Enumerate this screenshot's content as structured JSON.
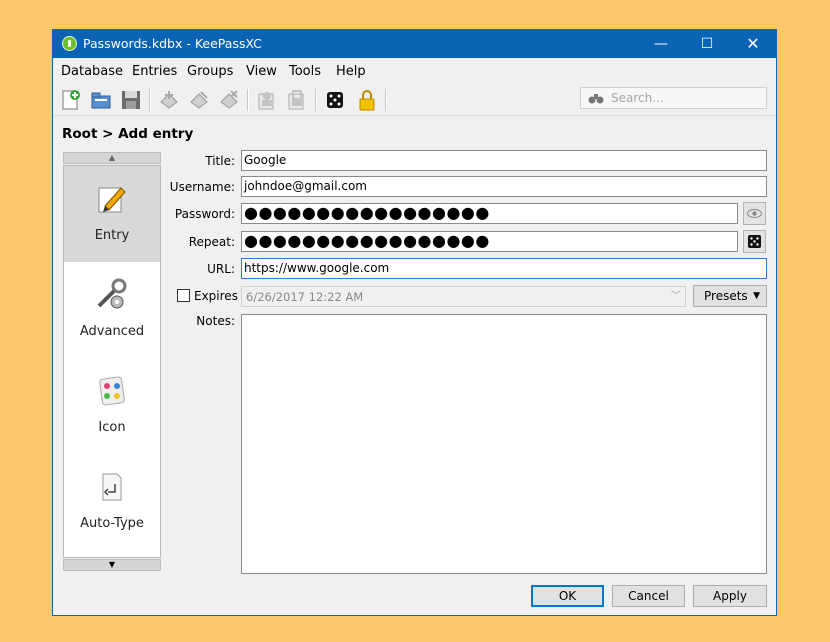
{
  "window": {
    "title": "Passwords.kdbx - KeePassXC",
    "controls": {
      "minimize": "—",
      "maximize": "☐",
      "close": "✕"
    }
  },
  "menu": [
    "Database",
    "Entries",
    "Groups",
    "View",
    "Tools",
    "Help"
  ],
  "toolbar": {
    "icons": [
      "new-database-icon",
      "open-database-icon",
      "save-database-icon",
      "add-entry-icon",
      "edit-entry-icon",
      "delete-entry-icon",
      "copy-username-icon",
      "copy-password-icon",
      "password-generator-icon",
      "lock-database-icon"
    ],
    "search_placeholder": "Search..."
  },
  "breadcrumb": "Root > Add entry",
  "categories": [
    {
      "label": "Entry",
      "icon": "pencil-note-icon",
      "selected": true
    },
    {
      "label": "Advanced",
      "icon": "tools-icon",
      "selected": false
    },
    {
      "label": "Icon",
      "icon": "palette-icon",
      "selected": false
    },
    {
      "label": "Auto-Type",
      "icon": "keyboard-enter-icon",
      "selected": false
    }
  ],
  "form": {
    "title_label": "Title:",
    "title_value": "Google",
    "username_label": "Username:",
    "username_value": "johndoe@gmail.com",
    "password_label": "Password:",
    "password_value": "●●●●●●●●●●●●●●●●●",
    "repeat_label": "Repeat:",
    "repeat_value": "●●●●●●●●●●●●●●●●●",
    "url_label": "URL:",
    "url_value": "https://www.google.com",
    "expires_label": "Expires",
    "expires_checked": false,
    "expires_value": "6/26/2017 12:22 AM",
    "presets_label": "Presets",
    "notes_label": "Notes:",
    "notes_value": ""
  },
  "buttons": {
    "ok": "OK",
    "cancel": "Cancel",
    "apply": "Apply"
  },
  "colors": {
    "titlebar": "#0b63b4",
    "background": "#fcc66b",
    "focus": "#2e7bcf"
  }
}
